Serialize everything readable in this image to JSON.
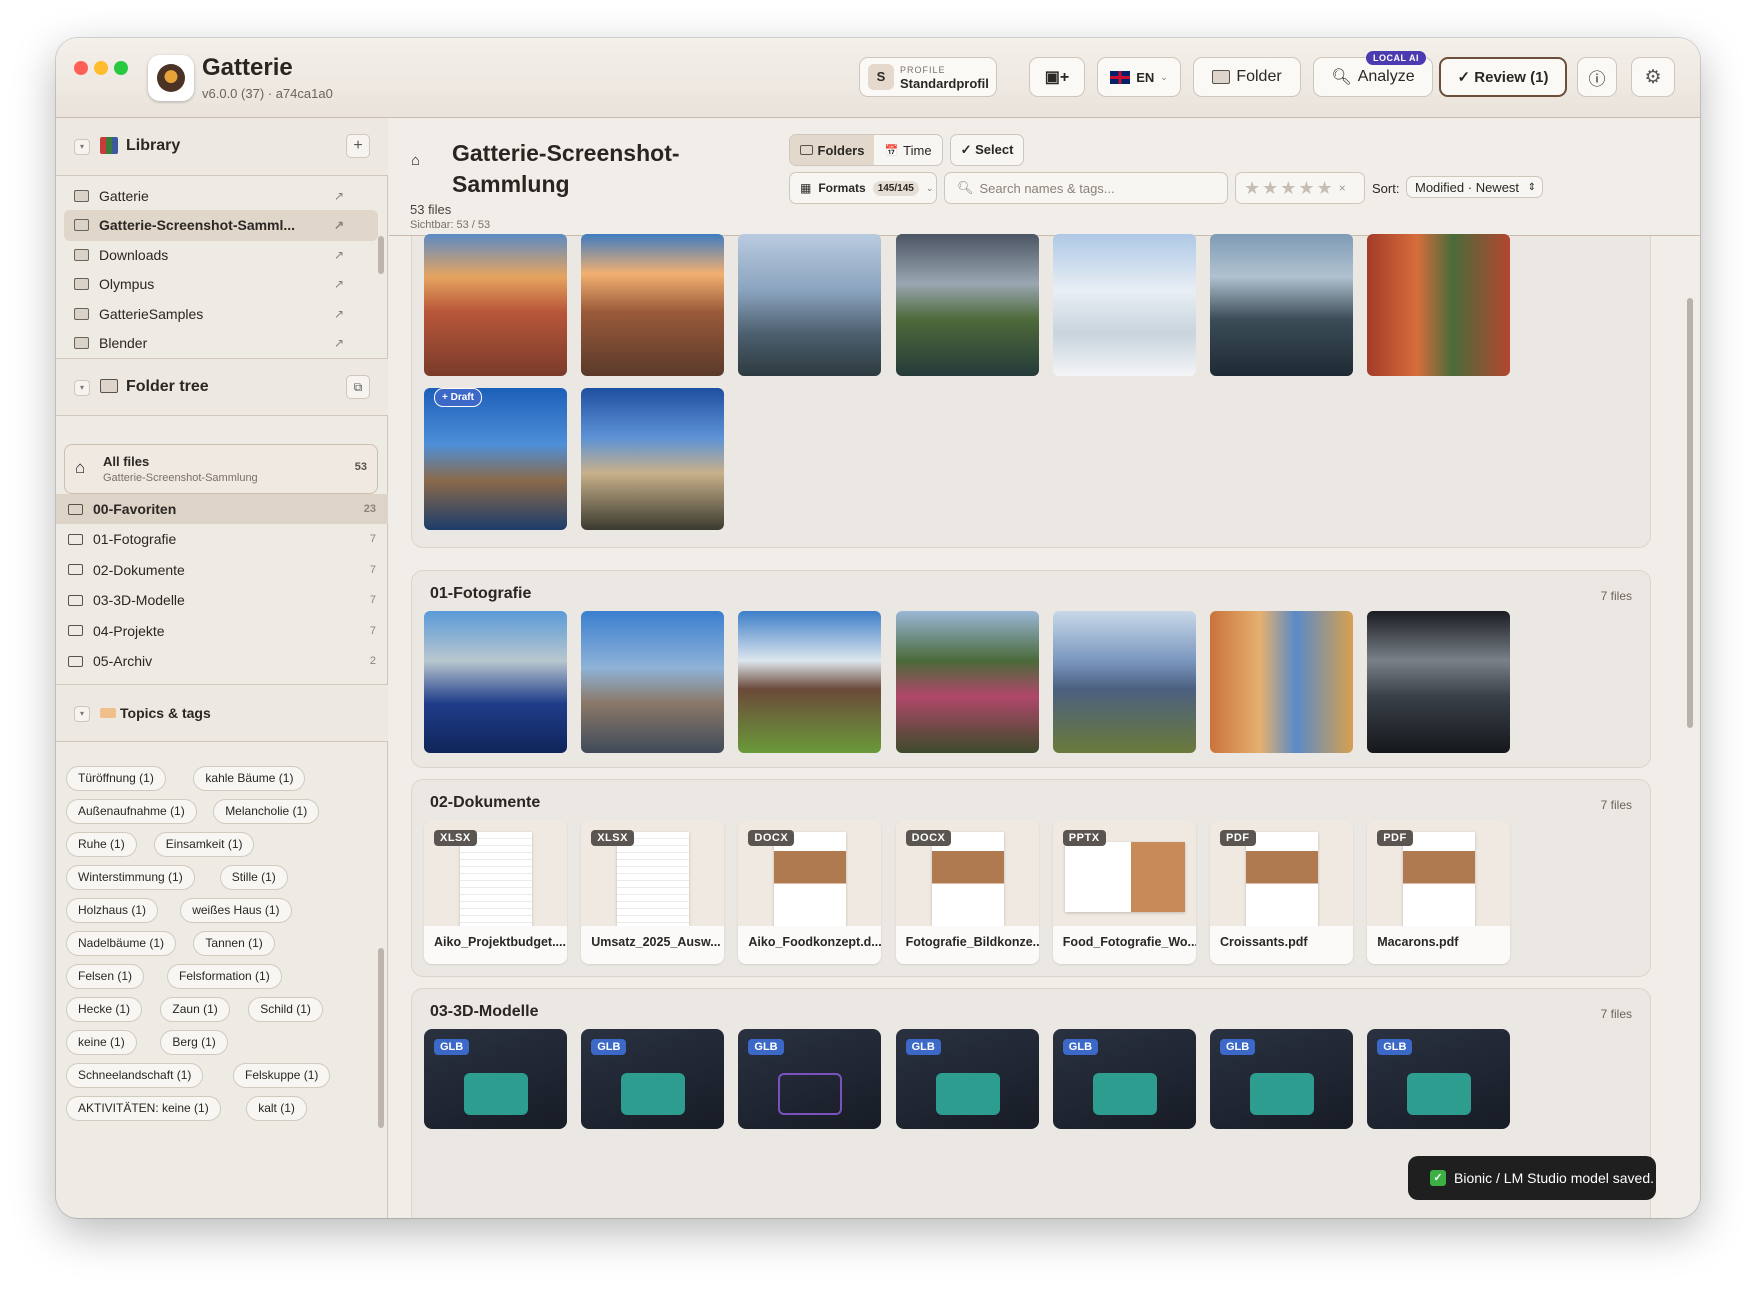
{
  "app": {
    "title": "Gatterie",
    "version": "v6.0.0 (37) · a74ca1a0"
  },
  "toolbar": {
    "profile_caption": "PROFILE",
    "profile_initial": "S",
    "profile_name": "Standardprofil",
    "lang": "EN",
    "folder": "Folder",
    "analyze": "Analyze",
    "ai_badge": "LOCAL AI",
    "review": "✓ Review (1)"
  },
  "sidebar": {
    "library_title": "Library",
    "library_items": [
      {
        "label": "Gatterie"
      },
      {
        "label": "Gatterie-Screenshot-Samml..."
      },
      {
        "label": "Downloads"
      },
      {
        "label": "Olympus"
      },
      {
        "label": "GatterieSamples"
      },
      {
        "label": "Blender"
      }
    ],
    "folder_tree_title": "Folder tree",
    "all_files": {
      "label": "All files",
      "sub": "Gatterie-Screenshot-Sammlung",
      "count": "53"
    },
    "tree": [
      {
        "label": "00-Favoriten",
        "count": "23"
      },
      {
        "label": "01-Fotografie",
        "count": "7"
      },
      {
        "label": "02-Dokumente",
        "count": "7"
      },
      {
        "label": "03-3D-Modelle",
        "count": "7"
      },
      {
        "label": "04-Projekte",
        "count": "7"
      },
      {
        "label": "05-Archiv",
        "count": "2"
      }
    ],
    "topics_title": "Topics & tags",
    "tags": [
      "Türöffnung (1)",
      "kahle Bäume (1)",
      "Außenaufnahme (1)",
      "Melancholie (1)",
      "Ruhe (1)",
      "Einsamkeit (1)",
      "Winterstimmung (1)",
      "Stille (1)",
      "Holzhaus (1)",
      "weißes Haus (1)",
      "Nadelbäume (1)",
      "Tannen (1)",
      "Felsen (1)",
      "Felsformation (1)",
      "Hecke (1)",
      "Zaun (1)",
      "Schild (1)",
      "keine (1)",
      "Berg (1)",
      "Schneelandschaft (1)",
      "Felskuppe (1)",
      "AKTIVITÄTEN: keine (1)",
      "kalt (1)"
    ]
  },
  "main": {
    "title": "Gatterie-Screenshot-Sammlung",
    "files": "53 files",
    "visible": "Sichtbar: 53 / 53",
    "view_folders": "Folders",
    "view_time": "Time",
    "select": "✓ Select",
    "formats": "Formats",
    "formats_count": "145/145",
    "search_placeholder": "Search names & tags...",
    "sort_label": "Sort:",
    "sort_value": "Modified · Newest",
    "draft_badge": "+ Draft",
    "sections": [
      {
        "title": "01-Fotografie",
        "count": "7 files"
      },
      {
        "title": "02-Dokumente",
        "count": "7 files"
      },
      {
        "title": "03-3D-Modelle",
        "count": "7 files"
      }
    ],
    "documents": [
      {
        "type": "XLSX",
        "name": "Aiko_Projektbudget...."
      },
      {
        "type": "XLSX",
        "name": "Umsatz_2025_Ausw..."
      },
      {
        "type": "DOCX",
        "name": "Aiko_Foodkonzept.d..."
      },
      {
        "type": "DOCX",
        "name": "Fotografie_Bildkonze..."
      },
      {
        "type": "PPTX",
        "name": "Food_Fotografie_Wo..."
      },
      {
        "type": "PDF",
        "name": "Croissants.pdf"
      },
      {
        "type": "PDF",
        "name": "Macarons.pdf"
      }
    ],
    "glb_label": "GLB"
  },
  "toast": "Bionic / LM Studio model saved."
}
